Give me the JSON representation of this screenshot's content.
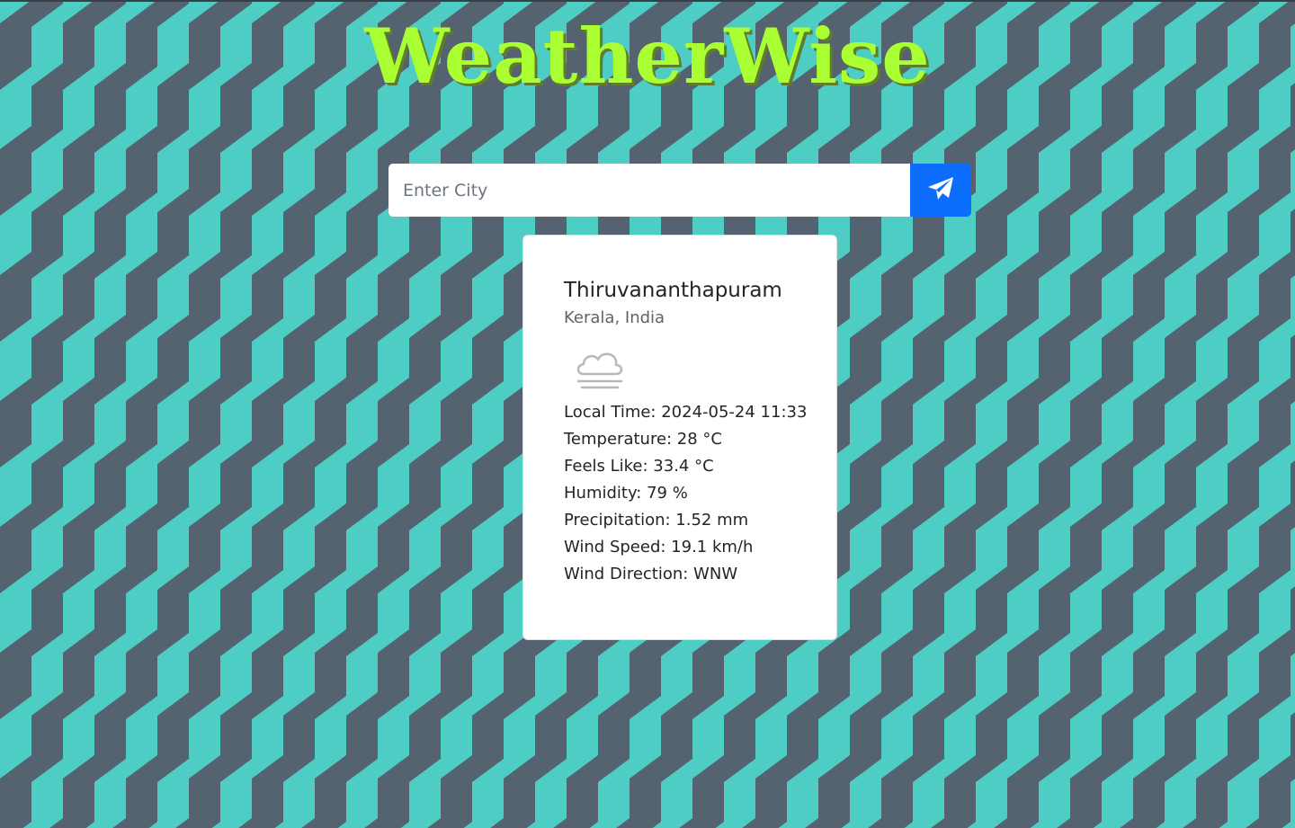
{
  "app": {
    "title": "WeatherWise"
  },
  "colors": {
    "pattern_light": "#4ecdc4",
    "pattern_dark": "#556270",
    "title": "#aaff33",
    "button": "#0d6efd"
  },
  "search": {
    "placeholder": "Enter City",
    "value": "",
    "button_icon": "paper-plane-icon"
  },
  "weather": {
    "city": "Thiruvananthapuram",
    "region": "Kerala, India",
    "condition_icon": "cloud-fog-icon",
    "details": {
      "local_time": "Local Time: 2024-05-24 11:33",
      "temperature": "Temperature: 28 °C",
      "feels_like": "Feels Like: 33.4 °C",
      "humidity": "Humidity: 79 %",
      "precipitation": "Precipitation: 1.52 mm",
      "wind_speed": "Wind Speed: 19.1 km/h",
      "wind_direction": "Wind Direction: WNW"
    }
  }
}
